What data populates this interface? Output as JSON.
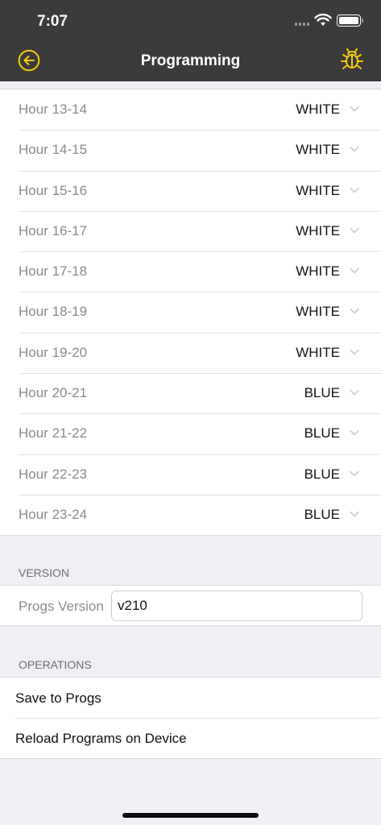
{
  "status_bar": {
    "time": "7:07"
  },
  "navbar": {
    "title": "Programming",
    "back_icon": "circle-arrow-left-icon",
    "debug_icon": "bug-icon",
    "accent": "#f5cb0c"
  },
  "schedule": {
    "rows": [
      {
        "label": "Hour 13-14",
        "value": "WHITE"
      },
      {
        "label": "Hour 14-15",
        "value": "WHITE"
      },
      {
        "label": "Hour 15-16",
        "value": "WHITE"
      },
      {
        "label": "Hour 16-17",
        "value": "WHITE"
      },
      {
        "label": "Hour 17-18",
        "value": "WHITE"
      },
      {
        "label": "Hour 18-19",
        "value": "WHITE"
      },
      {
        "label": "Hour 19-20",
        "value": "WHITE"
      },
      {
        "label": "Hour 20-21",
        "value": "BLUE"
      },
      {
        "label": "Hour 21-22",
        "value": "BLUE"
      },
      {
        "label": "Hour 22-23",
        "value": "BLUE"
      },
      {
        "label": "Hour 23-24",
        "value": "BLUE"
      }
    ]
  },
  "version": {
    "header": "VERSION",
    "label": "Progs Version",
    "value": "v210"
  },
  "operations": {
    "header": "OPERATIONS",
    "items": [
      {
        "label": "Save to Progs"
      },
      {
        "label": "Reload Programs on Device"
      }
    ]
  }
}
